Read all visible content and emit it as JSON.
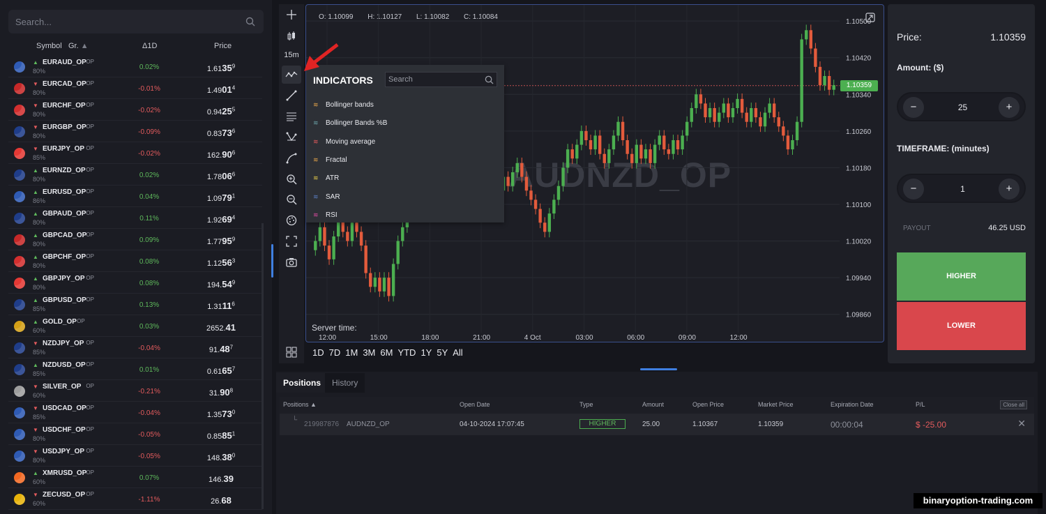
{
  "sidebar": {
    "search_placeholder": "Search...",
    "headers": {
      "symbol": "Symbol",
      "group": "Gr.",
      "delta": "Δ1D",
      "price": "Price"
    },
    "rows": [
      {
        "symbol": "EURAUD_OP",
        "op": "OP",
        "pct": "80%",
        "dir": "up",
        "change": "0.02%",
        "price_main": "1.61",
        "price_big": "35",
        "price_sup": "9",
        "flag": "#2f5bb5"
      },
      {
        "symbol": "EURCAD_OP",
        "op": "OP",
        "pct": "80%",
        "dir": "down",
        "change": "-0.01%",
        "price_main": "1.49",
        "price_big": "01",
        "price_sup": "4",
        "flag": "#c62828"
      },
      {
        "symbol": "EURCHF_OP",
        "op": "OP",
        "pct": "80%",
        "dir": "down",
        "change": "-0.02%",
        "price_main": "0.94",
        "price_big": "25",
        "price_sup": "5",
        "flag": "#d32f2f"
      },
      {
        "symbol": "EURGBP_OP",
        "op": "OP",
        "pct": "80%",
        "dir": "down",
        "change": "-0.09%",
        "price_main": "0.83",
        "price_big": "73",
        "price_sup": "6",
        "flag": "#1f3d8a"
      },
      {
        "symbol": "EURJPY_OP",
        "op": "OP",
        "pct": "85%",
        "dir": "down",
        "change": "-0.02%",
        "price_main": "162.",
        "price_big": "90",
        "price_sup": "6",
        "flag": "#e53935"
      },
      {
        "symbol": "EURNZD_OP",
        "op": "OP",
        "pct": "80%",
        "dir": "up",
        "change": "0.02%",
        "price_main": "1.78",
        "price_big": "06",
        "price_sup": "6",
        "flag": "#1f3d8a"
      },
      {
        "symbol": "EURUSD_OP",
        "op": "OP",
        "pct": "86%",
        "dir": "up",
        "change": "0.04%",
        "price_main": "1.09",
        "price_big": "79",
        "price_sup": "1",
        "flag": "#2f5bb5"
      },
      {
        "symbol": "GBPAUD_OP",
        "op": "OP",
        "pct": "80%",
        "dir": "up",
        "change": "0.11%",
        "price_main": "1.92",
        "price_big": "69",
        "price_sup": "4",
        "flag": "#1f3d8a"
      },
      {
        "symbol": "GBPCAD_OP",
        "op": "OP",
        "pct": "80%",
        "dir": "up",
        "change": "0.09%",
        "price_main": "1.77",
        "price_big": "95",
        "price_sup": "9",
        "flag": "#c62828"
      },
      {
        "symbol": "GBPCHF_OP",
        "op": "OP",
        "pct": "80%",
        "dir": "up",
        "change": "0.08%",
        "price_main": "1.12",
        "price_big": "56",
        "price_sup": "3",
        "flag": "#d32f2f"
      },
      {
        "symbol": "GBPJPY_OP",
        "op": "OP",
        "pct": "80%",
        "dir": "up",
        "change": "0.08%",
        "price_main": "194.",
        "price_big": "54",
        "price_sup": "9",
        "flag": "#e53935"
      },
      {
        "symbol": "GBPUSD_OP",
        "op": "OP",
        "pct": "85%",
        "dir": "up",
        "change": "0.13%",
        "price_main": "1.31",
        "price_big": "11",
        "price_sup": "6",
        "flag": "#1f3d8a"
      },
      {
        "symbol": "GOLD_OP",
        "op": "OP",
        "pct": "60%",
        "dir": "up",
        "change": "0.03%",
        "price_main": "2652.",
        "price_big": "41",
        "price_sup": "",
        "flag": "#d4a017"
      },
      {
        "symbol": "NZDJPY_OP",
        "op": "OP",
        "pct": "85%",
        "dir": "down",
        "change": "-0.04%",
        "price_main": "91.",
        "price_big": "48",
        "price_sup": "7",
        "flag": "#1f3d8a"
      },
      {
        "symbol": "NZDUSD_OP",
        "op": "OP",
        "pct": "85%",
        "dir": "up",
        "change": "0.01%",
        "price_main": "0.61",
        "price_big": "65",
        "price_sup": "7",
        "flag": "#1f3d8a"
      },
      {
        "symbol": "SILVER_OP",
        "op": "OP",
        "pct": "60%",
        "dir": "down",
        "change": "-0.21%",
        "price_main": "31.",
        "price_big": "90",
        "price_sup": "8",
        "flag": "#9e9e9e"
      },
      {
        "symbol": "USDCAD_OP",
        "op": "OP",
        "pct": "85%",
        "dir": "down",
        "change": "-0.04%",
        "price_main": "1.35",
        "price_big": "73",
        "price_sup": "0",
        "flag": "#2f5bb5"
      },
      {
        "symbol": "USDCHF_OP",
        "op": "OP",
        "pct": "80%",
        "dir": "down",
        "change": "-0.05%",
        "price_main": "0.85",
        "price_big": "85",
        "price_sup": "1",
        "flag": "#2f5bb5"
      },
      {
        "symbol": "USDJPY_OP",
        "op": "OP",
        "pct": "80%",
        "dir": "down",
        "change": "-0.05%",
        "price_main": "148.",
        "price_big": "38",
        "price_sup": "0",
        "flag": "#2f5bb5"
      },
      {
        "symbol": "XMRUSD_OP",
        "op": "OP",
        "pct": "60%",
        "dir": "up",
        "change": "0.07%",
        "price_main": "146.",
        "price_big": "39",
        "price_sup": "",
        "flag": "#f26822"
      },
      {
        "symbol": "ZECUSD_OP",
        "op": "OP",
        "pct": "60%",
        "dir": "down",
        "change": "-1.11%",
        "price_main": "26.",
        "price_big": "68",
        "price_sup": "",
        "flag": "#e8b30a"
      }
    ]
  },
  "toolbar": {
    "timeframe": "15m"
  },
  "chart": {
    "ohlc": {
      "o": "O: 1.10099",
      "h": "H: 1.10127",
      "l": "L: 1.10082",
      "c": "C: 1.10084"
    },
    "watermark": "AUDNZD_OP",
    "current_price_tag": "1.10359",
    "server_time_label": "Server time:",
    "y_ticks": [
      "1.10500",
      "1.10420",
      "1.10340",
      "1.10260",
      "1.10180",
      "1.10100",
      "1.10020",
      "1.09940",
      "1.09860"
    ],
    "x_ticks": [
      "12:00",
      "15:00",
      "18:00",
      "21:00",
      "4 Oct",
      "03:00",
      "06:00",
      "09:00",
      "12:00"
    ],
    "periods": [
      "1D",
      "7D",
      "1M",
      "3M",
      "6M",
      "YTD",
      "1Y",
      "5Y",
      "All"
    ]
  },
  "indicators": {
    "title": "INDICATORS",
    "search_placeholder": "Search",
    "items": [
      {
        "label": "Bollinger bands",
        "color": "#e2a34a"
      },
      {
        "label": "Bollinger Bands %B",
        "color": "#6aa0a6"
      },
      {
        "label": "Moving average",
        "color": "#e35b5d"
      },
      {
        "label": "Fractal",
        "color": "#e2a34a"
      },
      {
        "label": "ATR",
        "color": "#e2c84a"
      },
      {
        "label": "SAR",
        "color": "#5a7dc0"
      },
      {
        "label": "RSI",
        "color": "#d94ba0"
      }
    ]
  },
  "trade": {
    "price_label": "Price:",
    "price_value": "1.10359",
    "amount_label": "Amount: ($)",
    "amount_value": "25",
    "timeframe_label": "TIMEFRAME: (minutes)",
    "timeframe_value": "1",
    "payout_label": "PAYOUT",
    "payout_value": "46.25 USD",
    "higher_label": "HIGHER",
    "lower_label": "LOWER",
    "minus": "−",
    "plus": "+"
  },
  "positions": {
    "tab_positions": "Positions",
    "tab_history": "History",
    "headers": [
      "Positions ▲",
      "Open Date",
      "Type",
      "Amount",
      "Open Price",
      "Market Price",
      "Expiration Date",
      "P/L"
    ],
    "close_all": "Close all",
    "row": {
      "id": "219987876",
      "symbol": "AUDNZD_OP",
      "open_date": "04-10-2024 17:07:45",
      "type": "HIGHER",
      "amount": "25.00",
      "open_price": "1.10367",
      "market_price": "1.10359",
      "expiration": "00:00:04",
      "pl": "$ -25.00"
    }
  },
  "site_watermark": "binaryoption-trading.com",
  "chart_data": {
    "type": "candlestick",
    "symbol": "AUDNZD_OP",
    "interval": "15m",
    "y_range": [
      1.0982,
      1.1052
    ],
    "current_price": 1.10359,
    "x_labels": [
      "12:00",
      "15:00",
      "18:00",
      "21:00",
      "4 Oct",
      "03:00",
      "06:00",
      "09:00",
      "12:00"
    ],
    "closes": [
      1.1002,
      1.1005,
      1.1001,
      1.0998,
      1.1003,
      1.1008,
      1.1004,
      1.1002,
      1.1006,
      1.1004,
      1.1001,
      1.0995,
      1.0992,
      1.0994,
      1.0991,
      1.0994,
      1.099,
      1.0997,
      1.1002,
      1.1005,
      1.101,
      1.1014,
      1.1016,
      1.1013,
      1.1017,
      1.102,
      1.1016,
      1.1012,
      1.1009,
      1.1011,
      1.101,
      1.1013,
      1.1015,
      1.1012,
      1.101,
      1.1008,
      1.1011,
      1.1014,
      1.1012,
      1.101,
      1.1013,
      1.1016,
      1.1014,
      1.1017,
      1.1019,
      1.1016,
      1.1013,
      1.1011,
      1.1009,
      1.1006,
      1.1004,
      1.1008,
      1.1011,
      1.1014,
      1.1018,
      1.1022,
      1.102,
      1.1023,
      1.1026,
      1.1024,
      1.1022,
      1.1025,
      1.1021,
      1.1019,
      1.1022,
      1.1025,
      1.1028,
      1.1024,
      1.1021,
      1.1019,
      1.1023,
      1.102,
      1.1022,
      1.1019,
      1.1023,
      1.1025,
      1.1022,
      1.1021,
      1.1024,
      1.1022,
      1.1025,
      1.1028,
      1.1031,
      1.1034,
      1.1032,
      1.1029,
      1.1031,
      1.1028,
      1.103,
      1.1032,
      1.1029,
      1.1031,
      1.1033,
      1.103,
      1.1028,
      1.1031,
      1.1029,
      1.1027,
      1.103,
      1.1032,
      1.1029,
      1.1027,
      1.1025,
      1.1022,
      1.1024,
      1.1028,
      1.1046,
      1.1048,
      1.1044,
      1.104,
      1.1036,
      1.1038,
      1.1035,
      1.1036
    ]
  }
}
